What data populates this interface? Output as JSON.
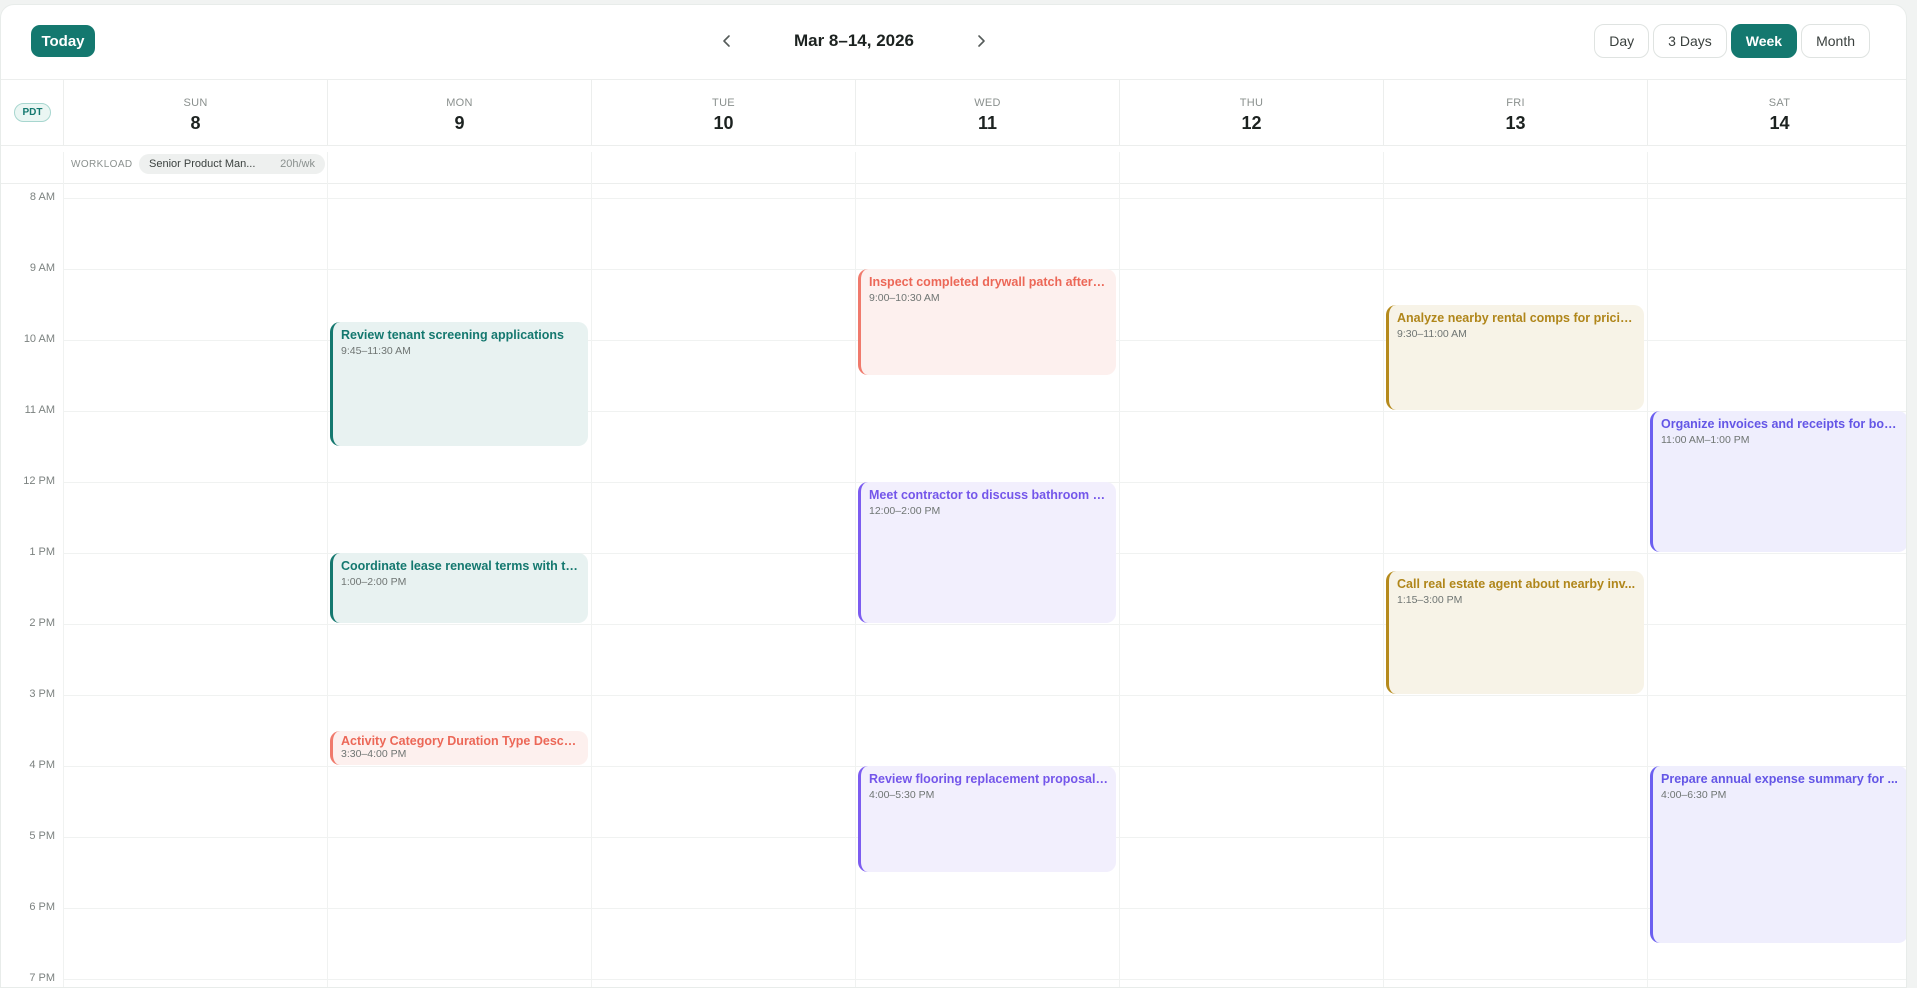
{
  "toolbar": {
    "today_label": "Today",
    "range_title": "Mar 8–14, 2026",
    "views": [
      {
        "label": "Day",
        "active": false
      },
      {
        "label": "3 Days",
        "active": false
      },
      {
        "label": "Week",
        "active": true
      },
      {
        "label": "Month",
        "active": false
      }
    ],
    "accent_color": "#14786f"
  },
  "timezone": "PDT",
  "days": [
    {
      "dow": "SUN",
      "num": "8"
    },
    {
      "dow": "MON",
      "num": "9"
    },
    {
      "dow": "TUE",
      "num": "10"
    },
    {
      "dow": "WED",
      "num": "11"
    },
    {
      "dow": "THU",
      "num": "12"
    },
    {
      "dow": "FRI",
      "num": "13"
    },
    {
      "dow": "SAT",
      "num": "14"
    }
  ],
  "workload": {
    "label": "WORKLOAD",
    "role": "Senior Product Man...",
    "hours": "20h/wk"
  },
  "hours": [
    "8 AM",
    "9 AM",
    "10 AM",
    "11 AM",
    "12 PM",
    "1 PM",
    "2 PM",
    "3 PM",
    "4 PM",
    "5 PM",
    "6 PM",
    "7 PM"
  ],
  "events": [
    {
      "day": 1,
      "start": 9.75,
      "end": 11.5,
      "color": "teal",
      "title": "Review tenant screening applications",
      "time": "9:45–11:30 AM"
    },
    {
      "day": 1,
      "start": 13.0,
      "end": 14.0,
      "color": "teal",
      "title": "Coordinate lease renewal terms with te...",
      "time": "1:00–2:00 PM"
    },
    {
      "day": 1,
      "start": 15.5,
      "end": 16.0,
      "color": "red",
      "title": "Activity Category Duration Type Descri...",
      "time": "3:30–4:00 PM"
    },
    {
      "day": 3,
      "start": 9.0,
      "end": 10.5,
      "color": "red",
      "title": "Inspect completed drywall patch after r...",
      "time": "9:00–10:30 AM"
    },
    {
      "day": 3,
      "start": 12.0,
      "end": 14.0,
      "color": "purple",
      "title": "Meet contractor to discuss bathroom u...",
      "time": "12:00–2:00 PM"
    },
    {
      "day": 3,
      "start": 16.0,
      "end": 17.5,
      "color": "purple",
      "title": "Review flooring replacement proposal ...",
      "time": "4:00–5:30 PM"
    },
    {
      "day": 5,
      "start": 9.5,
      "end": 11.0,
      "color": "gold",
      "title": "Analyze nearby rental comps for pricin...",
      "time": "9:30–11:00 AM"
    },
    {
      "day": 5,
      "start": 13.25,
      "end": 15.0,
      "color": "gold",
      "title": "Call real estate agent about nearby inv...",
      "time": "1:15–3:00 PM"
    },
    {
      "day": 6,
      "start": 11.0,
      "end": 13.0,
      "color": "indigo",
      "title": "Organize invoices and receipts for boo...",
      "time": "11:00 AM–1:00 PM"
    },
    {
      "day": 6,
      "start": 16.0,
      "end": 18.5,
      "color": "indigo",
      "title": "Prepare annual expense summary for ...",
      "time": "4:00–6:30 PM"
    }
  ]
}
